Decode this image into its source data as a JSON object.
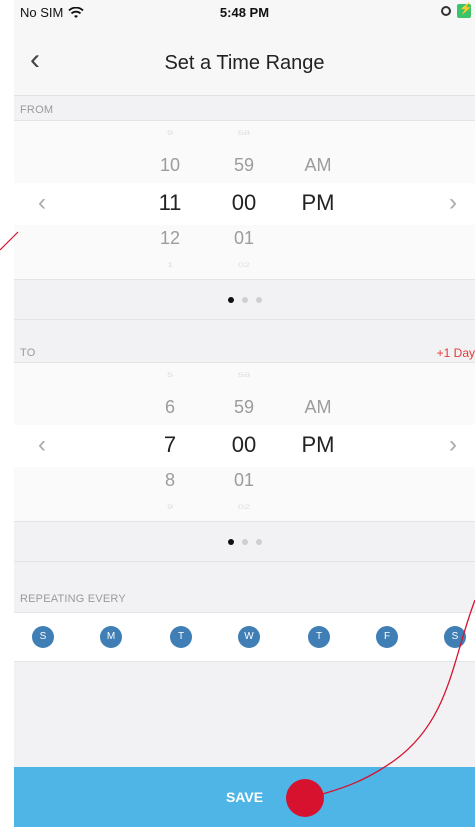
{
  "status_bar": {
    "carrier": "No SIM",
    "time": "5:48 PM"
  },
  "nav": {
    "title": "Set a Time Range"
  },
  "from": {
    "label": "FROM",
    "hours": [
      "9",
      "10",
      "11",
      "12",
      "1"
    ],
    "minutes": [
      "58",
      "59",
      "00",
      "01",
      "02"
    ],
    "ampm": [
      "AM",
      "PM"
    ]
  },
  "to": {
    "label": "TO",
    "next_day": "+1 Day",
    "hours": [
      "5",
      "6",
      "7",
      "8",
      "9"
    ],
    "minutes": [
      "58",
      "59",
      "00",
      "01",
      "02"
    ],
    "ampm": [
      "AM",
      "PM"
    ]
  },
  "repeat": {
    "label": "REPEATING EVERY",
    "days": [
      "S",
      "M",
      "T",
      "W",
      "T",
      "F",
      "S"
    ]
  },
  "save_label": "SAVE",
  "colors": {
    "accent": "#4fb4e6",
    "day_circle": "#3f7fb5",
    "annotation": "#d6122f",
    "next_day": "#e53935"
  },
  "icons": {
    "back": "chevron-left-icon",
    "prev": "chevron-left-icon",
    "next": "chevron-right-icon"
  }
}
